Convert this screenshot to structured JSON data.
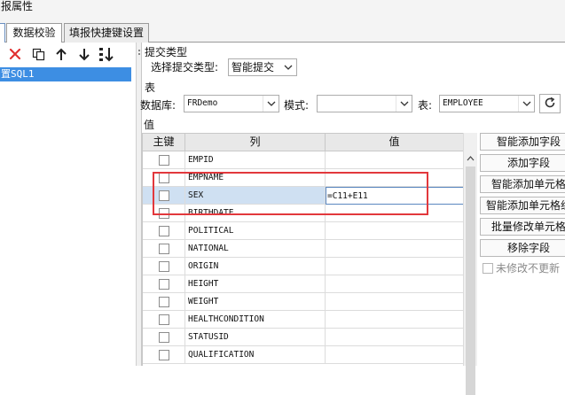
{
  "window": {
    "title": "报属性"
  },
  "tabs": [
    {
      "label": "数据校验",
      "active": true
    },
    {
      "label": "填报快捷键设置",
      "active": false
    }
  ],
  "left": {
    "toolbar": [
      "close-icon",
      "copy-icon",
      "arrow-up-icon",
      "arrow-down-icon",
      "sort-icon"
    ],
    "tree_item": "置SQL1"
  },
  "submit_type": {
    "section": "提交类型",
    "label": "选择提交类型:",
    "value": "智能提交"
  },
  "table_section": {
    "section": "表",
    "db_label": "数据库:",
    "db_value": "FRDemo",
    "mode_label": "模式:",
    "mode_value": "",
    "table_label": "表:",
    "table_value": "EMPLOYEE",
    "refresh_icon": "refresh-icon"
  },
  "value_section": {
    "section": "值"
  },
  "grid": {
    "headers": [
      "主键",
      "列",
      "值"
    ],
    "rows": [
      {
        "column": "EMPID",
        "value": "",
        "selected": false
      },
      {
        "column": "EMPNAME",
        "value": "",
        "selected": false
      },
      {
        "column": "SEX",
        "value": "=C11+E11",
        "selected": true
      },
      {
        "column": "BIRTHDATE",
        "value": "",
        "selected": false
      },
      {
        "column": "POLITICAL",
        "value": "",
        "selected": false
      },
      {
        "column": "NATIONAL",
        "value": "",
        "selected": false
      },
      {
        "column": "ORIGIN",
        "value": "",
        "selected": false
      },
      {
        "column": "HEIGHT",
        "value": "",
        "selected": false
      },
      {
        "column": "WEIGHT",
        "value": "",
        "selected": false
      },
      {
        "column": "HEALTHCONDITION",
        "value": "",
        "selected": false
      },
      {
        "column": "STATUSID",
        "value": "",
        "selected": false
      },
      {
        "column": "QUALIFICATION",
        "value": "",
        "selected": false
      }
    ]
  },
  "side_buttons": [
    "智能添加字段",
    "添加字段",
    "智能添加单元格",
    "智能添加单元格组",
    "批量修改单元格",
    "移除字段"
  ],
  "checkbox": {
    "label": "未修改不更新"
  },
  "colors": {
    "selection": "#3d8ee3",
    "highlight_box": "#e2383c",
    "close_icon": "#e03030"
  }
}
